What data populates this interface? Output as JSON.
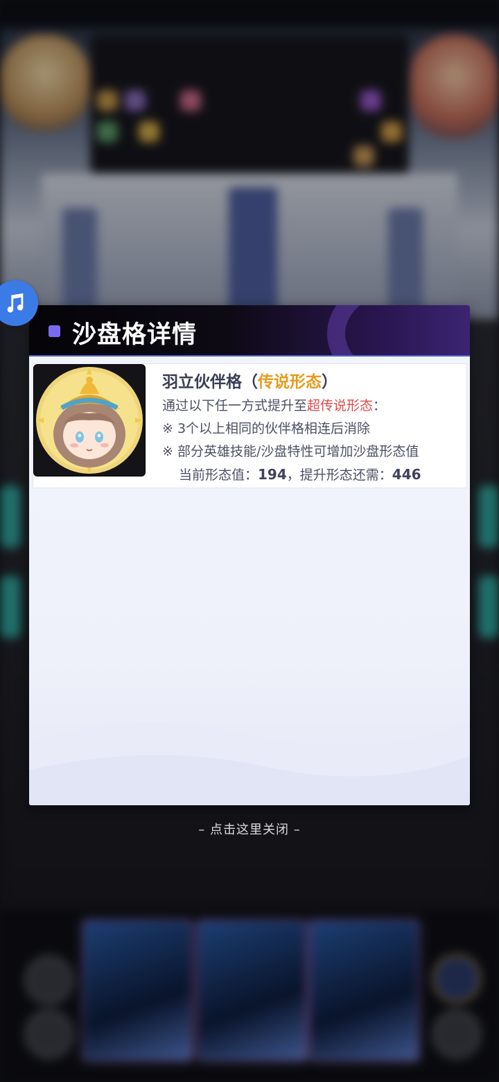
{
  "music_button": {
    "icon": "music-note-icon"
  },
  "dialog": {
    "title": "沙盘格详情",
    "item": {
      "name": "羽立伙伴格",
      "paren_open": "（",
      "form_label": "传说形态",
      "paren_close": "）",
      "desc_prefix": "通过以下任一方式提升至",
      "desc_highlight": "超传说形态",
      "desc_suffix": "：",
      "rule1": "※ 3个以上相同的伙伴格相连后消除",
      "rule2": "※ 部分英雄技能/沙盘特性可增加沙盘形态值",
      "current_label": "当前形态值：",
      "current_value": "194",
      "needed_label": "，提升形态还需：",
      "needed_value": "446"
    }
  },
  "close_hint": "– 点击这里关闭 –",
  "colors": {
    "accent_purple": "#7a6af0",
    "form_gold": "#e89a1c",
    "highlight_red": "#e04a4a",
    "music_blue": "#3b7be8"
  }
}
